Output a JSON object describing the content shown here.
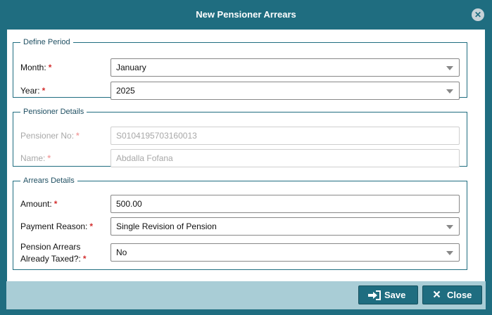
{
  "dialog": {
    "title": "New Pensioner Arrears",
    "close_icon": "close-circle-icon"
  },
  "define_period": {
    "legend": "Define Period",
    "month": {
      "label": "Month:",
      "value": "January"
    },
    "year": {
      "label": "Year:",
      "value": "2025"
    }
  },
  "pensioner_details": {
    "legend": "Pensioner Details",
    "pensioner_no": {
      "label": "Pensioner No:",
      "value": "S0104195703160013"
    },
    "name": {
      "label": "Name:",
      "value": "Abdalla Fofana"
    }
  },
  "arrears_details": {
    "legend": "Arrears Details",
    "amount": {
      "label": "Amount:",
      "value": "500.00"
    },
    "payment_reason": {
      "label": "Payment Reason:",
      "value": "Single Revision of Pension"
    },
    "already_taxed": {
      "label_line1": "Pension Arrears",
      "label_line2": "Already Taxed?:",
      "value": "No"
    }
  },
  "footer": {
    "save_label": "Save",
    "close_label": "Close"
  },
  "required_marker": "*",
  "colors": {
    "primary": "#1f6d80",
    "footer_bg": "#a9cdd6",
    "required": "#d32f2f"
  }
}
